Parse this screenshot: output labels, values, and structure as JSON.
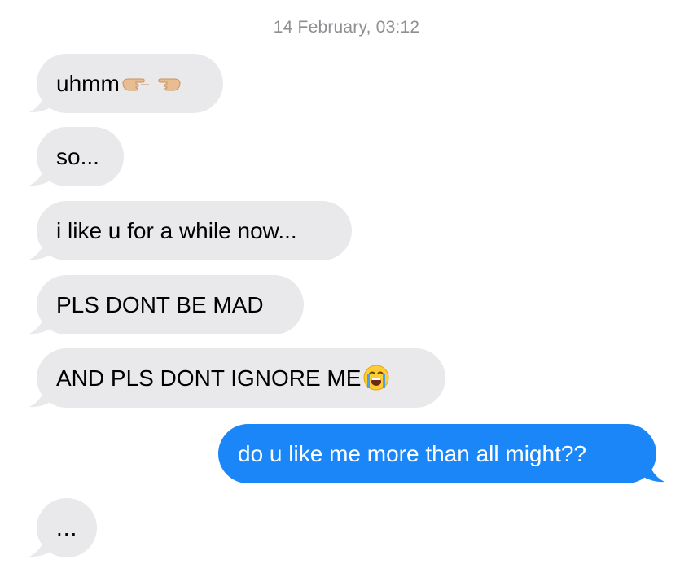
{
  "conversation": {
    "timestamp": "14 February, 03:12",
    "messages": [
      {
        "direction": "incoming",
        "text": "uhmm",
        "emoji_icons": [
          "pointing-right-hand-icon",
          "pointing-left-hand-icon"
        ]
      },
      {
        "direction": "incoming",
        "text": "so..."
      },
      {
        "direction": "incoming",
        "text": "i like u for a while now..."
      },
      {
        "direction": "incoming",
        "text": "PLS DONT BE MAD"
      },
      {
        "direction": "incoming",
        "text": "AND PLS DONT IGNORE ME",
        "emoji_icons": [
          "loudly-crying-face-icon"
        ]
      },
      {
        "direction": "outgoing",
        "text": "do u like me more than all might??"
      },
      {
        "direction": "incoming",
        "text": "..."
      }
    ]
  },
  "colors": {
    "incoming_bubble": "#e9e9eb",
    "outgoing_bubble": "#1b86f7",
    "timestamp_text": "#8e8e93"
  }
}
